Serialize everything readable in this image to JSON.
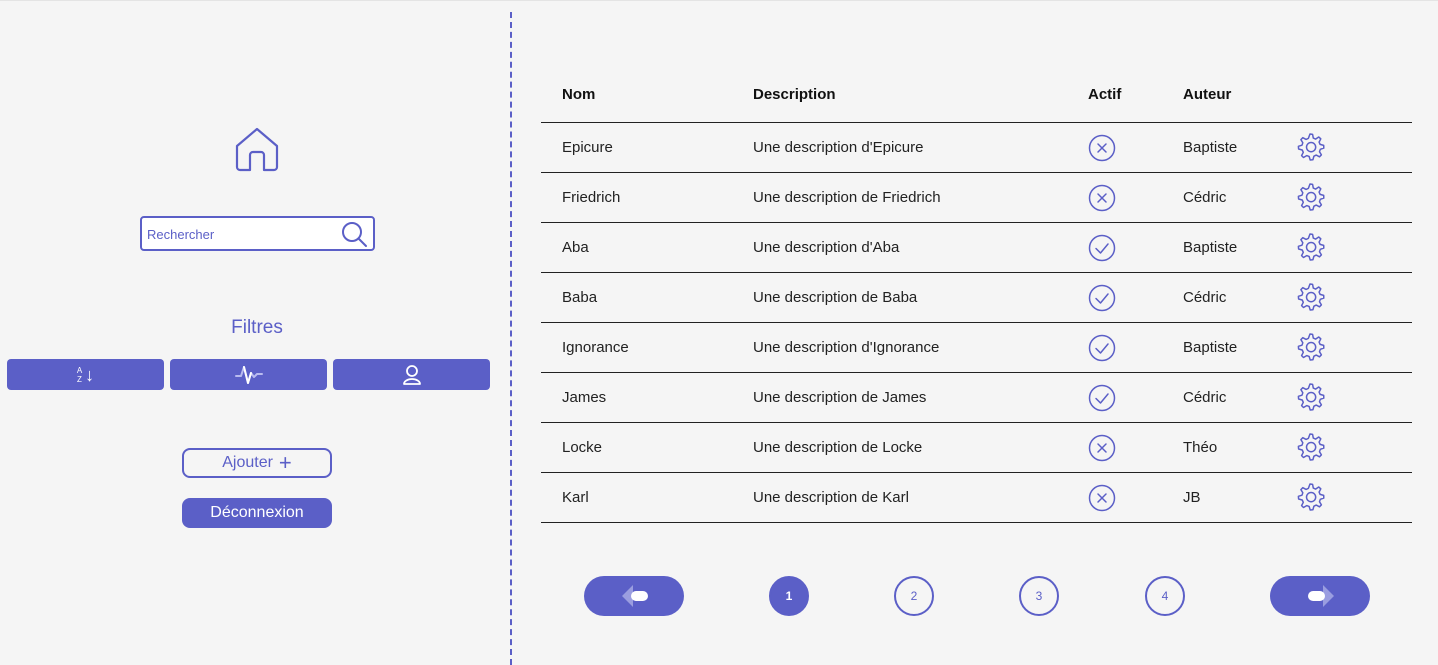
{
  "sidebar": {
    "search": {
      "placeholder": "Rechercher"
    },
    "filters_title": "Filtres",
    "filter_buttons": [
      {
        "icon": "sort-az-icon",
        "sort_a": "A",
        "sort_z": "Z",
        "arrow": "↓"
      },
      {
        "icon": "activity-icon"
      },
      {
        "icon": "user-icon"
      }
    ],
    "add_label": "Ajouter",
    "add_glyph": "+",
    "logout_label": "Déconnexion"
  },
  "table": {
    "headers": {
      "nom": "Nom",
      "description": "Description",
      "actif": "Actif",
      "auteur": "Auteur"
    },
    "rows": [
      {
        "nom": "Epicure",
        "description": "Une description d'Epicure",
        "actif": false,
        "auteur": "Baptiste"
      },
      {
        "nom": "Friedrich",
        "description": "Une description de Friedrich",
        "actif": false,
        "auteur": "Cédric"
      },
      {
        "nom": "Aba",
        "description": "Une description d'Aba",
        "actif": true,
        "auteur": "Baptiste"
      },
      {
        "nom": "Baba",
        "description": "Une description de Baba",
        "actif": true,
        "auteur": "Cédric"
      },
      {
        "nom": "Ignorance",
        "description": "Une description d'Ignorance",
        "actif": true,
        "auteur": "Baptiste"
      },
      {
        "nom": "James",
        "description": "Une description de James",
        "actif": true,
        "auteur": "Cédric"
      },
      {
        "nom": "Locke",
        "description": "Une description de Locke",
        "actif": false,
        "auteur": "Théo"
      },
      {
        "nom": "Karl",
        "description": "Une description de Karl",
        "actif": false,
        "auteur": "JB"
      }
    ]
  },
  "pagination": {
    "pages": [
      "1",
      "2",
      "3",
      "4"
    ],
    "current": "1"
  },
  "colors": {
    "accent": "#5b5fc7",
    "background": "#f5f5f5"
  }
}
